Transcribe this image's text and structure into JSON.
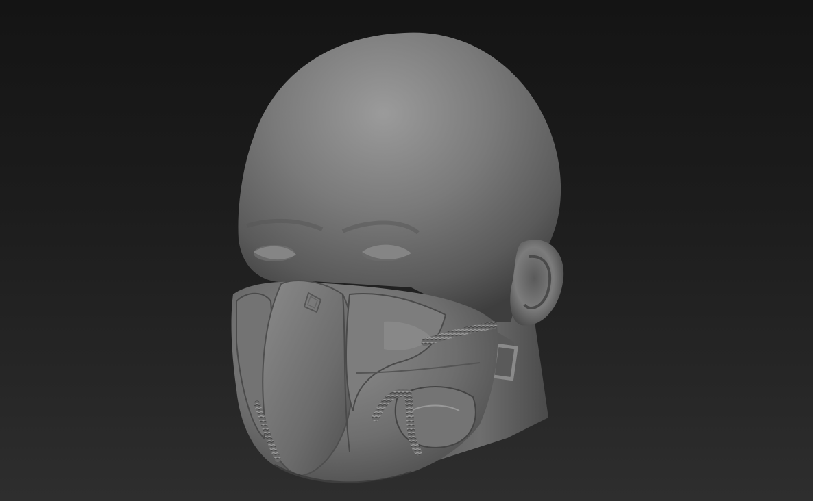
{
  "canvas": {
    "background_top": "#141414",
    "background_bottom": "#2e2e2e"
  },
  "model": {
    "subject": "sculpted-head-with-respirator-mask",
    "material_color": "#7a7a7a",
    "highlight_color": "#9a9a9a",
    "shadow_color": "#3a3a3a"
  }
}
